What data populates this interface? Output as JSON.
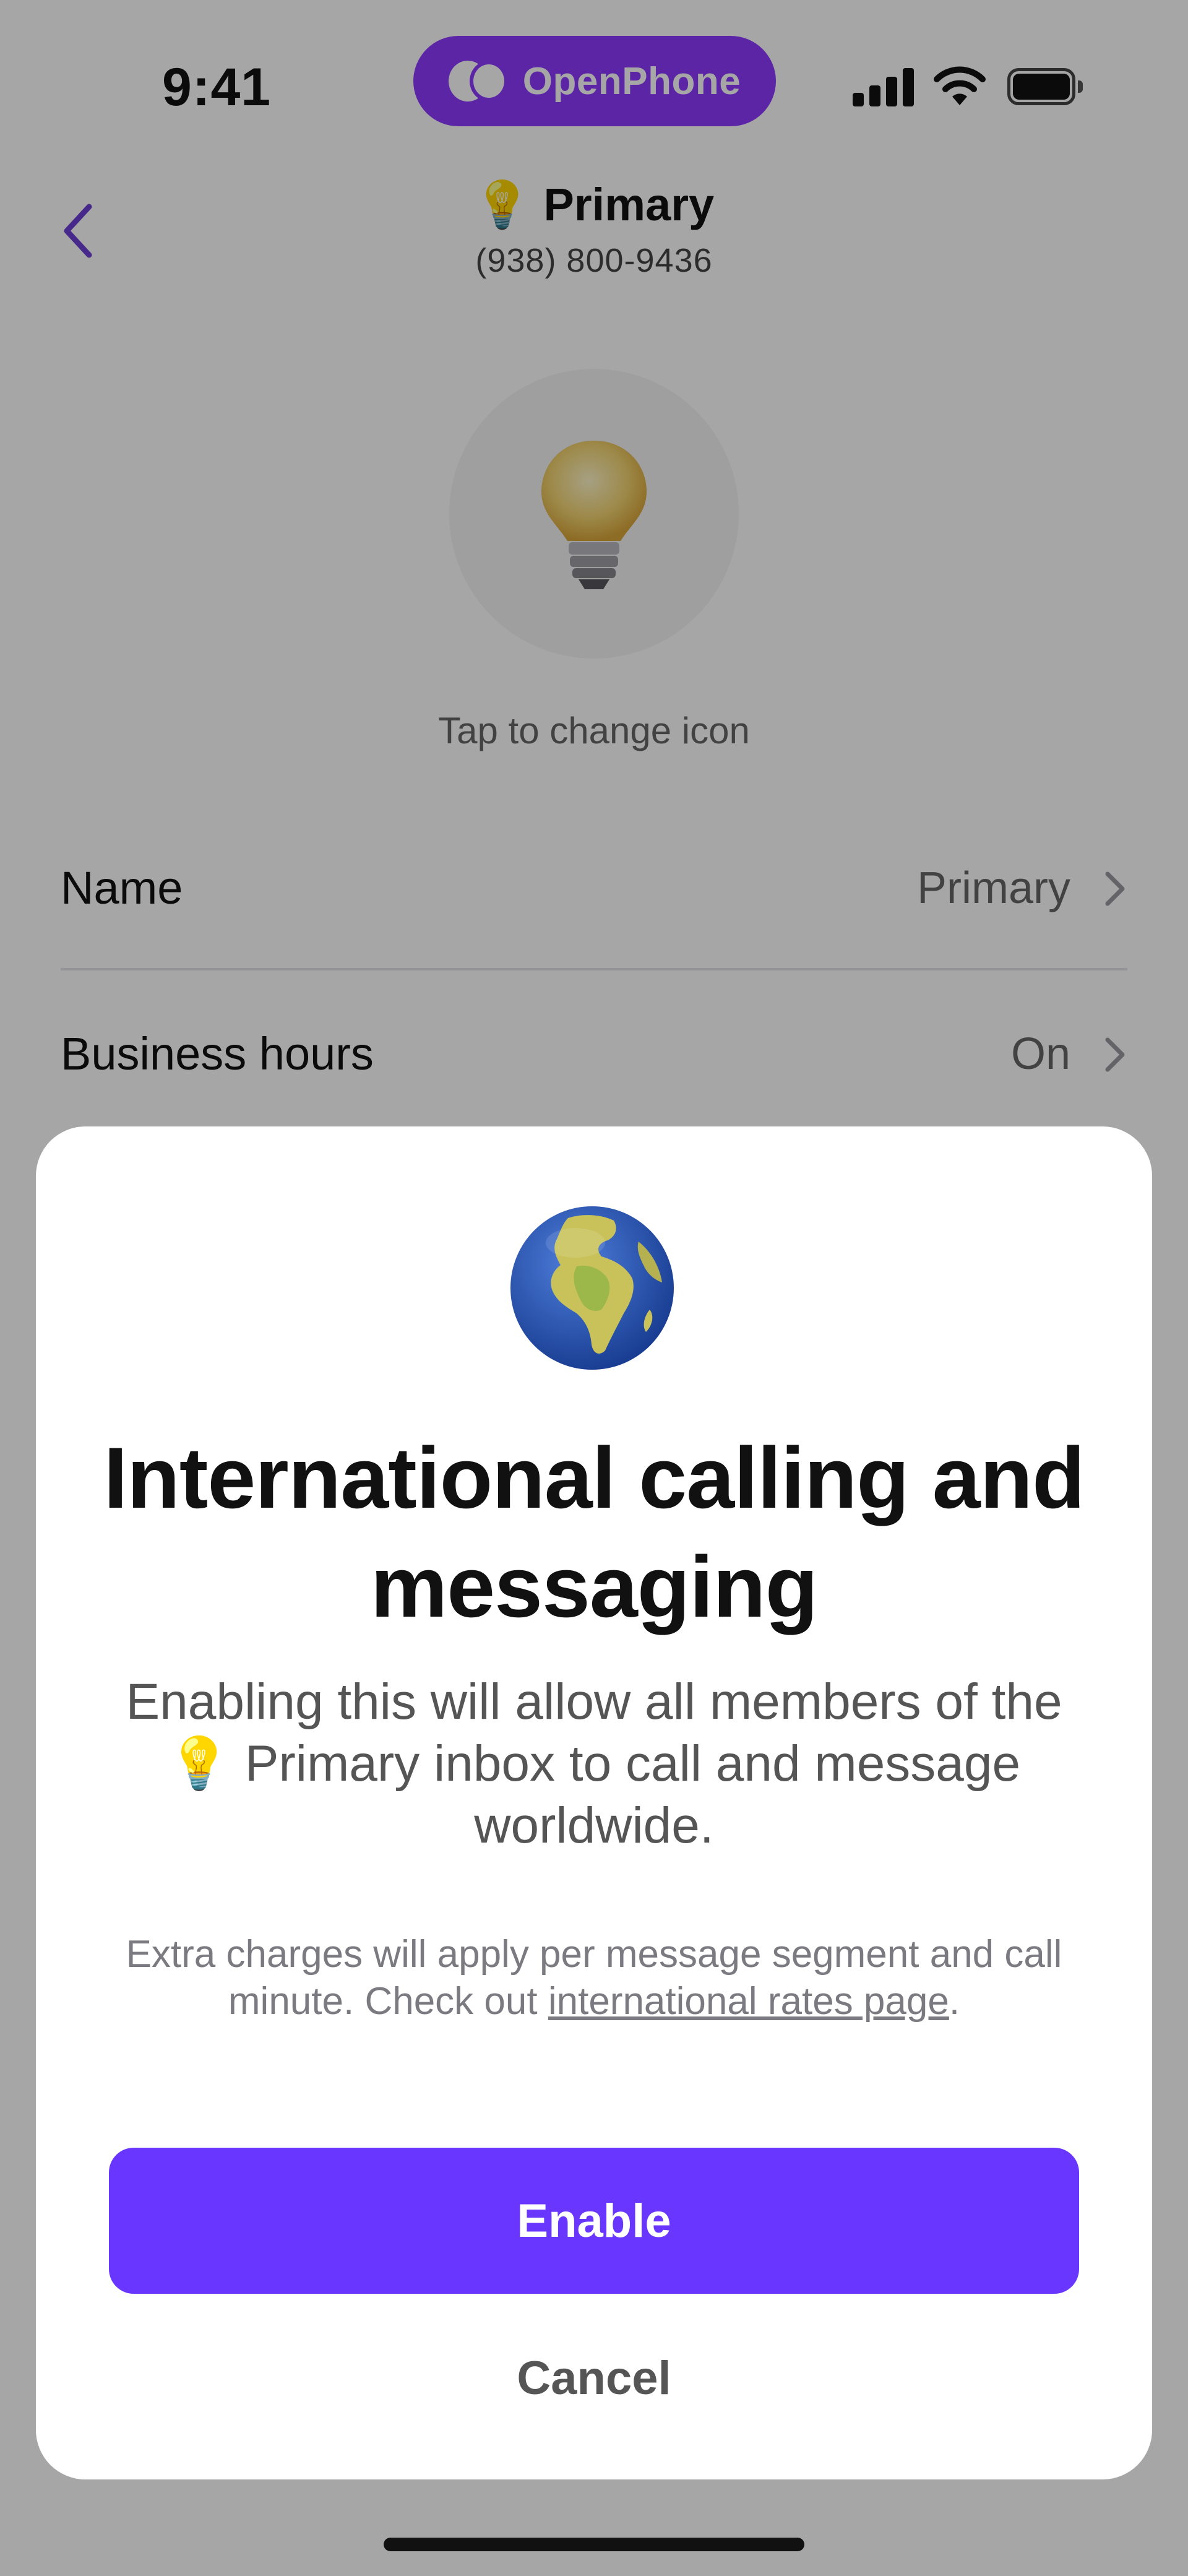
{
  "status_bar": {
    "time": "9:41",
    "brand": "OpenPhone",
    "brand_color": "#8d39ff"
  },
  "header": {
    "title_emoji": "💡",
    "title": "Primary",
    "phone": "(938) 800-9436",
    "back_icon": "chevron-left-icon",
    "accent_color": "#6d3fd8"
  },
  "icon_section": {
    "icon": "lightbulb-icon",
    "tap_label": "Tap to change icon"
  },
  "settings": {
    "rows": [
      {
        "label": "Name",
        "value": "Primary"
      },
      {
        "label": "Business hours",
        "value": "On"
      }
    ]
  },
  "modal": {
    "icon": "globe-icon",
    "title": "International calling and messaging",
    "body_prefix": "Enabling this will allow all members of the",
    "body_emoji": "💡",
    "body_suffix": "Primary inbox to call and message worldwide.",
    "note_prefix": "Extra charges will apply per message segment and call minute. Check out",
    "note_link": "international rates page",
    "note_suffix": ".",
    "enable_label": "Enable",
    "cancel_label": "Cancel",
    "enable_color": "#6936ff"
  }
}
